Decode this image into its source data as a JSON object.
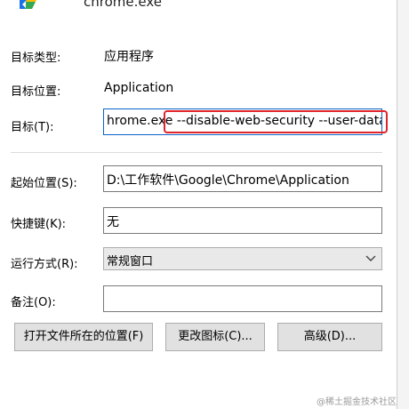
{
  "app": {
    "name": "chrome.exe",
    "icon": "chrome-icon"
  },
  "fields": {
    "target_type": {
      "label": "目标类型:",
      "value": "应用程序"
    },
    "target_location": {
      "label": "目标位置:",
      "value": "Application"
    },
    "target": {
      "label": "目标(T):",
      "value_prefix": "hrome.exe",
      "value_highlight": "--disable-web-security --user-data-dir"
    },
    "start_in": {
      "label": "起始位置(S):",
      "value": "D:\\工作软件\\Google\\Chrome\\Application"
    },
    "shortcut_key": {
      "label": "快捷键(K):",
      "value": "无"
    },
    "run": {
      "label": "运行方式(R):",
      "value": "常规窗口",
      "icon": "chevron-down-icon"
    },
    "comment": {
      "label": "备注(O):",
      "value": ""
    }
  },
  "buttons": {
    "open_location": "打开文件所在的位置(F)",
    "change_icon": "更改图标(C)...",
    "advanced": "高级(D)..."
  },
  "watermark": "@稀土掘金技术社区",
  "colors": {
    "highlight": "#e0242a",
    "focus_border": "#0a64c8"
  }
}
